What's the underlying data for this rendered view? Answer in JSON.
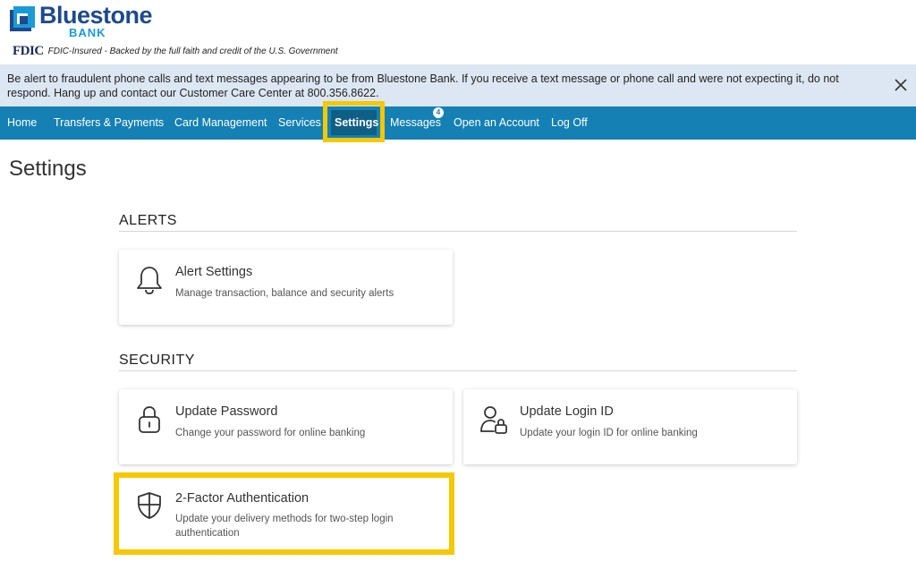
{
  "brand": {
    "name": "Bluestone",
    "sub": "BANK",
    "fdic_logo": "FDIC",
    "fdic_text": "FDIC-Insured - Backed by the full faith and credit of the U.S. Government",
    "colors": {
      "primary": "#1e4a8c",
      "accent": "#1a9bd7"
    }
  },
  "banner": {
    "text": "Be alert to fraudulent phone calls and text messages appearing to be from Bluestone Bank. If you receive a text message or phone call and were not expecting it, do not respond. Hang up and contact our Customer Care Center at 800.356.8622.",
    "close_icon": "close-icon"
  },
  "nav": {
    "items": [
      {
        "label": "Home"
      },
      {
        "label": "Transfers & Payments"
      },
      {
        "label": "Card Management"
      },
      {
        "label": "Services"
      },
      {
        "label": "Settings",
        "active": true
      },
      {
        "label": "Messages",
        "badge": "4"
      },
      {
        "label": "Open an Account"
      },
      {
        "label": "Log Off"
      }
    ],
    "color": "#1580b3"
  },
  "page": {
    "title": "Settings"
  },
  "sections": {
    "alerts": {
      "title": "ALERTS",
      "cards": [
        {
          "title": "Alert Settings",
          "desc": "Manage transaction, balance and security alerts",
          "icon": "bell-icon"
        }
      ]
    },
    "security": {
      "title": "SECURITY",
      "cards": [
        {
          "title": "Update Password",
          "desc": "Change your password for online banking",
          "icon": "lock-icon"
        },
        {
          "title": "Update Login ID",
          "desc": "Update your login ID for online banking",
          "icon": "user-lock-icon"
        },
        {
          "title": "2-Factor Authentication",
          "desc": "Update your delivery methods for two-step login authentication",
          "icon": "shield-icon"
        }
      ]
    }
  },
  "highlight_color": "#f5c800"
}
